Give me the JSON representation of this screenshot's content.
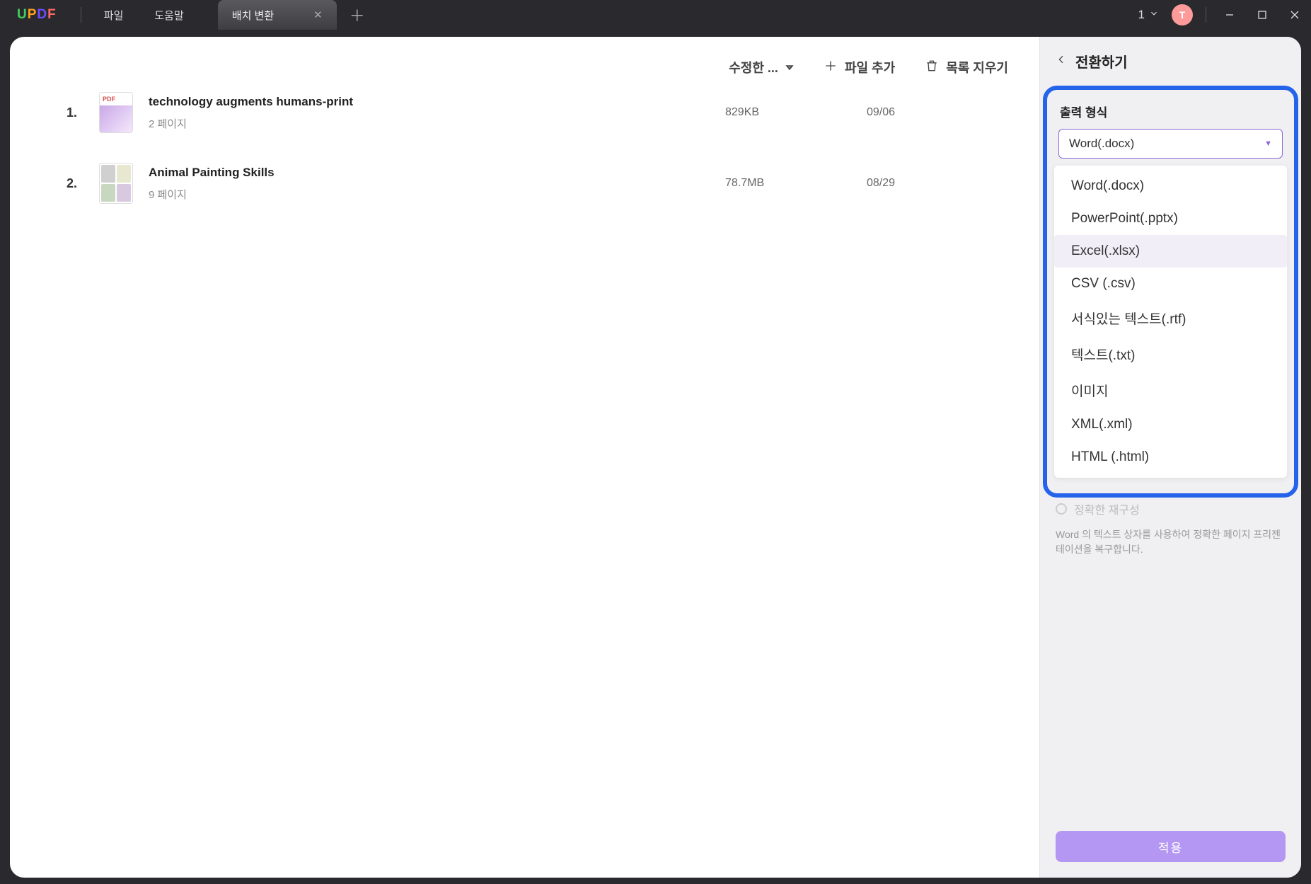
{
  "app": {
    "logo": "UPDF"
  },
  "menu": {
    "file": "파일",
    "help": "도움말"
  },
  "tab": {
    "label": "배치 변환"
  },
  "titlebar": {
    "tabcount": "1",
    "avatar": "T"
  },
  "toolbar": {
    "sort": "수정한 ...",
    "add": "파일 추가",
    "clear": "목록 지우기"
  },
  "files": [
    {
      "idx": "1.",
      "name": "technology augments humans-print",
      "pages": "2 페이지",
      "size": "829KB",
      "date": "09/06"
    },
    {
      "idx": "2.",
      "name": "Animal Painting Skills",
      "pages": "9 페이지",
      "size": "78.7MB",
      "date": "08/29"
    }
  ],
  "panel": {
    "title": "전환하기",
    "format_label": "출력 형식",
    "selected": "Word(.docx)",
    "options": [
      "Word(.docx)",
      "PowerPoint(.pptx)",
      "Excel(.xlsx)",
      "CSV (.csv)",
      "서식있는 텍스트(.rtf)",
      "텍스트(.txt)",
      "이미지",
      "XML(.xml)",
      "HTML (.html)"
    ],
    "radio_label": "정확한 재구성",
    "desc": "Word 의 텍스트 상자를 사용하여 정확한 페이지 프리젠테이션을 복구합니다.",
    "apply": "적용"
  }
}
